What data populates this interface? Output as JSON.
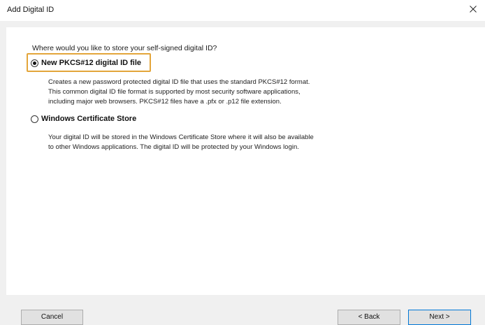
{
  "window": {
    "title": "Add Digital ID",
    "close_icon": "close-icon"
  },
  "content": {
    "question": "Where would you like to store your self-signed digital ID?",
    "options": [
      {
        "label": "New PKCS#12 digital ID file",
        "selected": true,
        "description_lines": [
          "Creates a new password protected digital ID file that uses the standard PKCS#12 format.",
          "This common digital ID file format is supported by most security software applications,",
          "including major web browsers. PKCS#12 files have a .pfx or .p12 file extension."
        ]
      },
      {
        "label": "Windows Certificate Store",
        "selected": false,
        "description_lines": [
          "Your digital ID will be stored in the Windows Certificate Store where it will also be available",
          "to other Windows applications. The digital ID will be protected by your Windows login."
        ]
      }
    ]
  },
  "buttons": {
    "cancel": "Cancel",
    "back": "< Back",
    "next": "Next >"
  },
  "colors": {
    "highlight": "#e3a53a",
    "panel_background": "#ffffff",
    "dialog_background": "#f0f0f0"
  }
}
